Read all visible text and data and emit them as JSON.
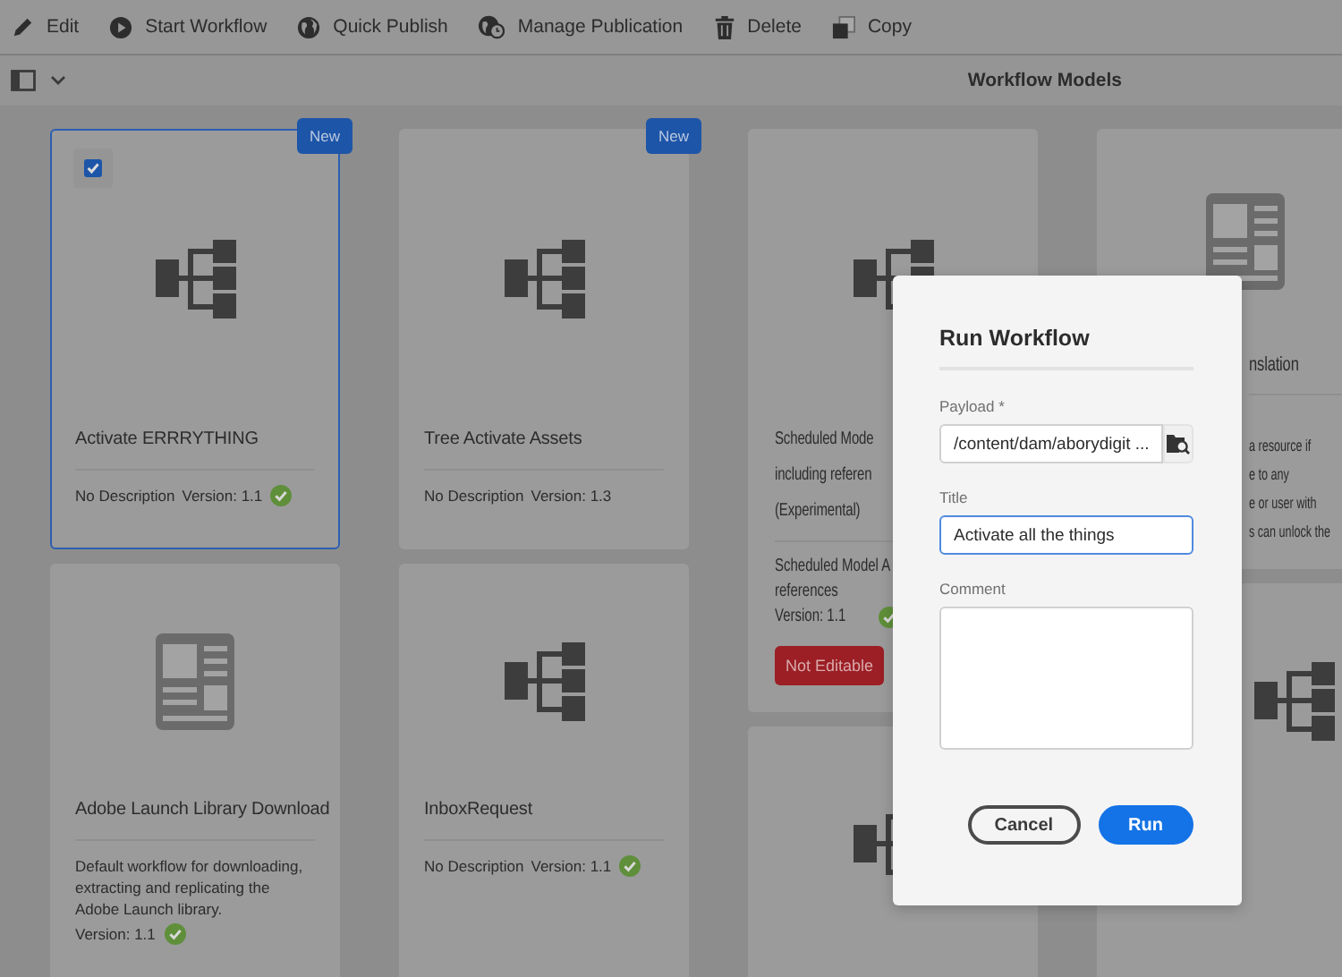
{
  "toolbar": [
    {
      "label": "Edit"
    },
    {
      "label": "Start Workflow"
    },
    {
      "label": "Quick Publish"
    },
    {
      "label": "Manage Publication"
    },
    {
      "label": "Delete"
    },
    {
      "label": "Copy"
    }
  ],
  "header": {
    "title": "Workflow Models"
  },
  "columns": [
    [
      {
        "kind": "workflow",
        "selected": true,
        "badge": "New",
        "title_lines": [
          "Activate ERRRYTHING"
        ],
        "description_lines": [
          "No Description"
        ],
        "version": "Version: 1.1",
        "deployed": true
      },
      {
        "kind": "document",
        "selected": false,
        "title_lines": [
          "Adobe Launch Library Download"
        ],
        "description_lines": [
          "Default workflow for downloading, extracting and replicating the Adobe Launch library."
        ],
        "version": "Version: 1.1",
        "deployed": true
      }
    ],
    [
      {
        "kind": "workflow",
        "selected": false,
        "badge": "New",
        "title_lines": [
          "Tree Activate Assets"
        ],
        "description_lines": [
          "No Description"
        ],
        "version": "Version: 1.3",
        "deployed": false
      },
      {
        "kind": "workflow",
        "selected": false,
        "title_lines": [
          "InboxRequest"
        ],
        "description_lines": [
          "No Description"
        ],
        "version": "Version: 1.1",
        "deployed": true
      }
    ],
    [
      {
        "kind": "workflow",
        "selected": false,
        "title_lines": [
          "Scheduled Mode",
          "including referen",
          "(Experimental)"
        ],
        "description_lines": [
          "Scheduled Model A",
          "references"
        ],
        "version": "Version: 1.1",
        "deployed": true,
        "status_badge": "Not Editable"
      },
      {
        "kind": "workflow",
        "selected": false
      }
    ],
    [
      {
        "kind": "document",
        "selected": false,
        "title_lines": [
          "nslation"
        ],
        "description_lines": [
          "a resource if",
          "e to any",
          "e or user with",
          "s can unlock the"
        ]
      },
      {
        "kind": "workflow",
        "selected": false
      }
    ]
  ],
  "dialog": {
    "title": "Run Workflow",
    "fields": [
      {
        "kind": "picker",
        "label": "Payload *",
        "value": "/content/dam/aborydigit ...",
        "focused": false
      },
      {
        "kind": "text",
        "label": "Title",
        "value": "Activate all the things",
        "focused": true
      },
      {
        "kind": "textarea",
        "label": "Comment",
        "focused": false
      }
    ],
    "buttons": [
      {
        "label": "Cancel",
        "primary": false
      },
      {
        "label": "Run",
        "primary": true
      }
    ]
  }
}
